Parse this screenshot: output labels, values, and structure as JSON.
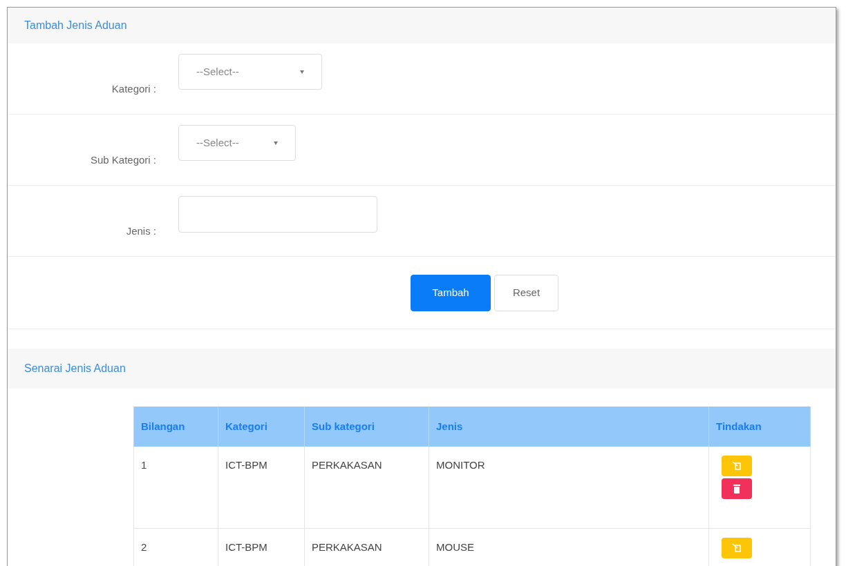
{
  "form": {
    "title": "Tambah Jenis Aduan",
    "fields": [
      {
        "kind": "select",
        "label": "Kategori :",
        "value": "--Select--",
        "wide": true
      },
      {
        "kind": "select",
        "label": "Sub Kategori :",
        "value": "--Select--",
        "wide": false
      },
      {
        "kind": "text",
        "label": "Jenis :"
      }
    ],
    "buttons": [
      {
        "label": "Tambah",
        "kind": "primary"
      },
      {
        "label": "Reset",
        "kind": "default"
      }
    ]
  },
  "list": {
    "title": "Senarai Jenis Aduan",
    "table": {
      "columns": [
        "Bilangan",
        "Kategori",
        "Sub kategori",
        "Jenis",
        "Tindakan"
      ],
      "rows": [
        {
          "cells": [
            "1",
            "ICT-BPM",
            "PERKAKASAN",
            "MONITOR"
          ],
          "actions": [
            {
              "kind": "edit"
            },
            {
              "kind": "delete"
            }
          ]
        },
        {
          "cells": [
            "2",
            "ICT-BPM",
            "PERKAKASAN",
            "MOUSE"
          ],
          "actions": [
            {
              "kind": "edit"
            }
          ]
        }
      ]
    }
  }
}
